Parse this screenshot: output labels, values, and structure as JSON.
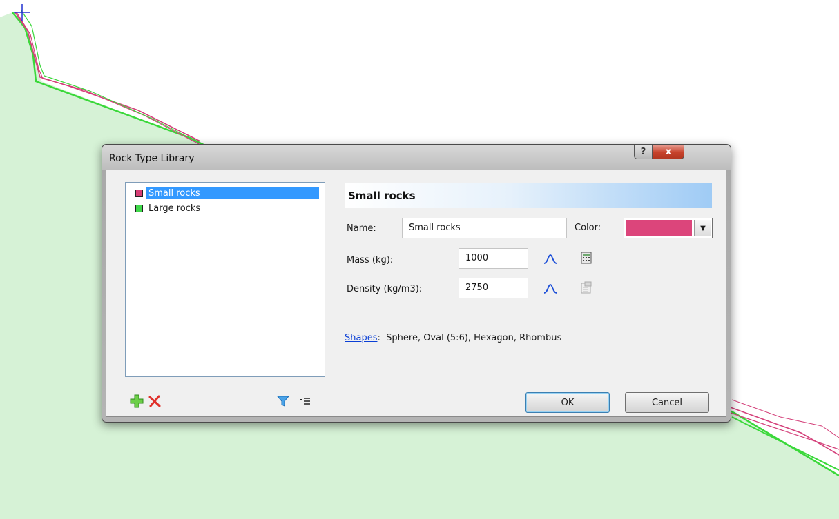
{
  "background": {
    "terrain_fill": "#d6f2d6",
    "terrain_line": "#3ad83a",
    "path_color": "#d4407a",
    "marker_color": "#2030d0"
  },
  "dialog": {
    "title": "Rock Type Library",
    "help_glyph": "?",
    "close_glyph": "x"
  },
  "rock_list": {
    "items": [
      {
        "label": "Small rocks",
        "color": "#d63d74",
        "selected": true
      },
      {
        "label": "Large rocks",
        "color": "#3fd84a",
        "selected": false
      }
    ]
  },
  "list_toolbar": {
    "add_icon": "add-icon",
    "delete_icon": "delete-icon",
    "filter_icon": "filter-icon",
    "menu_icon": "list-options-icon"
  },
  "details": {
    "header": "Small rocks",
    "name_label": "Name:",
    "name_value": "Small rocks",
    "color_label": "Color:",
    "color_value": "#dc457b",
    "mass_label": "Mass (kg):",
    "mass_value": "1000",
    "density_label": "Density (kg/m3):",
    "density_value": "2750",
    "shapes_link": "Shapes",
    "shapes_colon": ":",
    "shapes_value": "Sphere, Oval (5:6), Hexagon, Rhombus"
  },
  "buttons": {
    "ok": "OK",
    "cancel": "Cancel"
  }
}
